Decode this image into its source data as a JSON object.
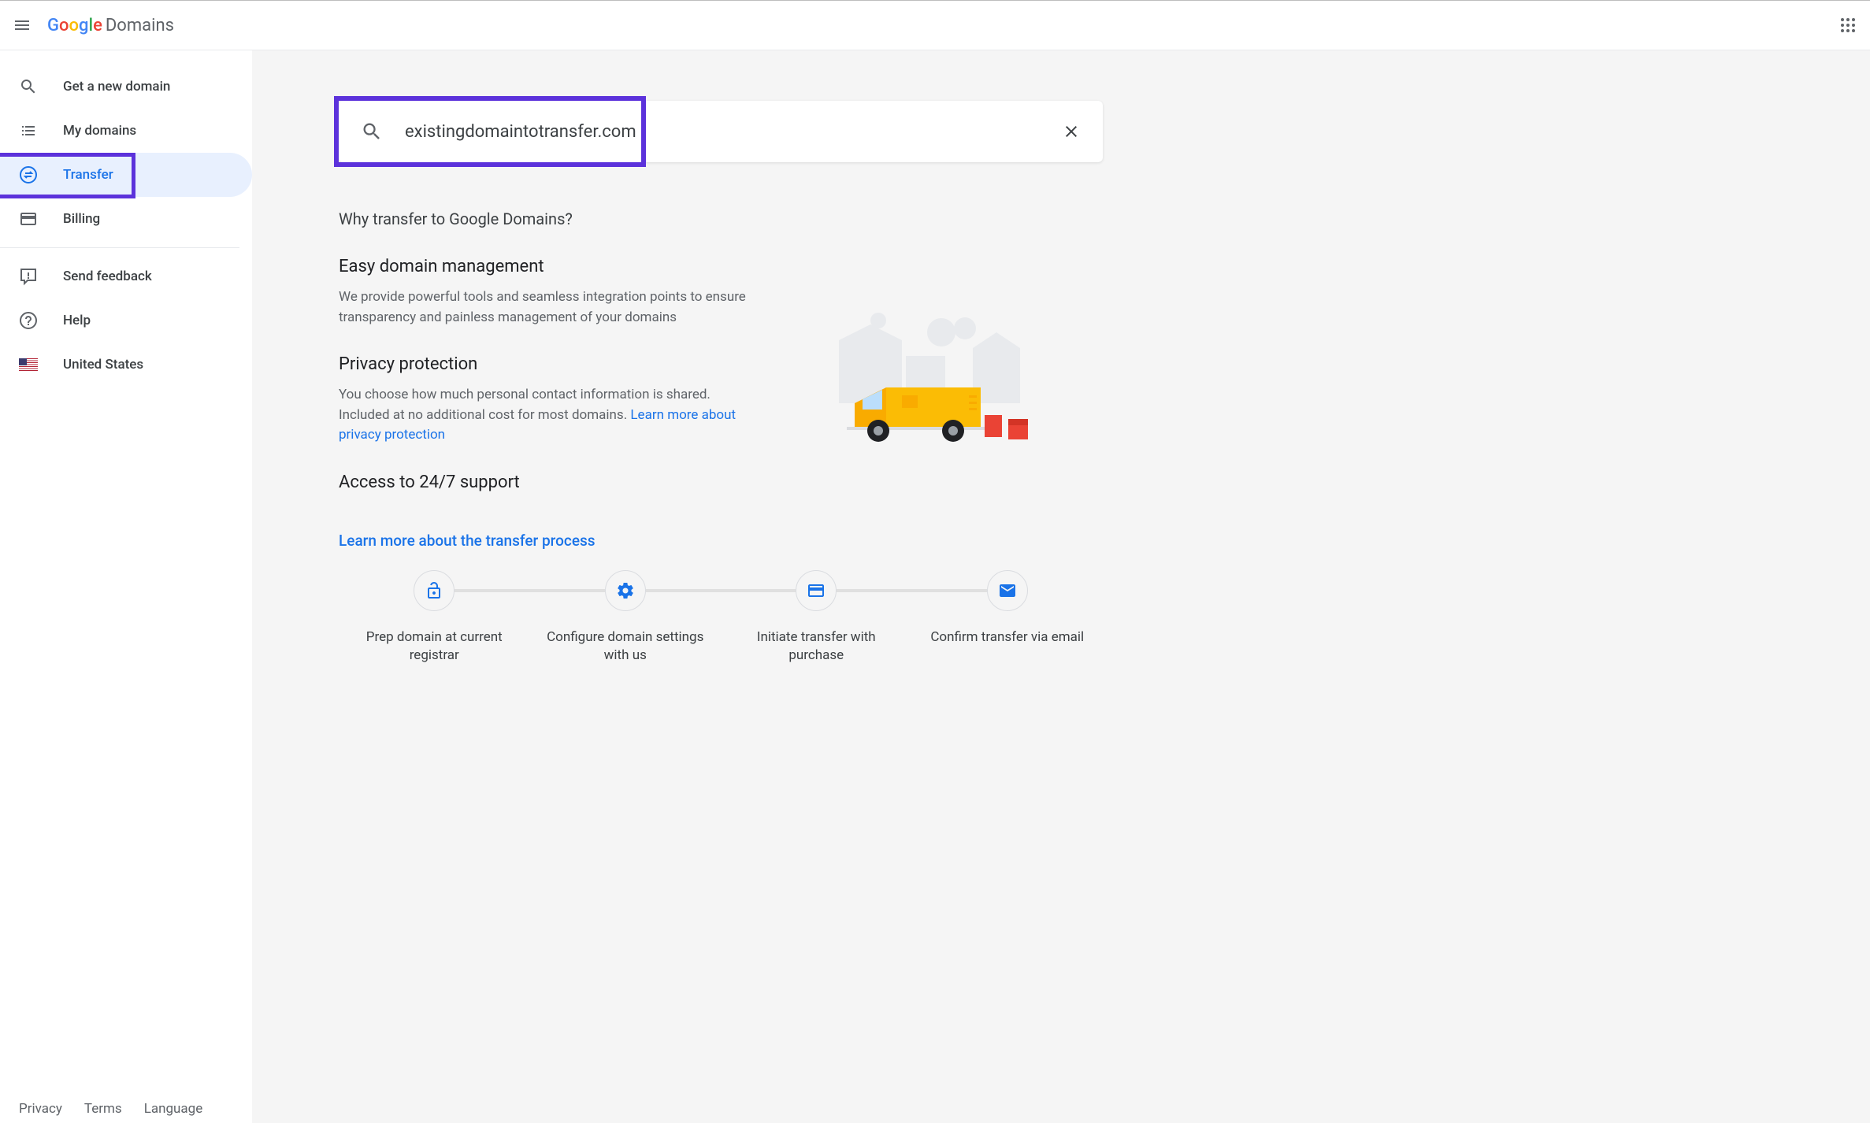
{
  "header": {
    "logo_suffix": "Domains"
  },
  "sidebar": {
    "items": [
      {
        "label": "Get a new domain"
      },
      {
        "label": "My domains"
      },
      {
        "label": "Transfer"
      },
      {
        "label": "Billing"
      },
      {
        "label": "Send feedback"
      },
      {
        "label": "Help"
      },
      {
        "label": "United States"
      }
    ],
    "footer": {
      "privacy": "Privacy",
      "terms": "Terms",
      "language": "Language"
    }
  },
  "search": {
    "value": "existingdomaintotransfer.com"
  },
  "content": {
    "section_title": "Why transfer to Google Domains?",
    "features": [
      {
        "title": "Easy domain management",
        "body": "We provide powerful tools and seamless integration points to ensure transparency and painless management of your domains"
      },
      {
        "title": "Privacy protection",
        "body": "You choose how much personal contact information is shared. Included at no additional cost for most domains. ",
        "link": "Learn more about privacy protection"
      },
      {
        "title": "Access to 24/7 support",
        "body": ""
      }
    ],
    "learn_link": "Learn more about the transfer process",
    "steps": [
      {
        "label": "Prep domain at current registrar"
      },
      {
        "label": "Configure domain settings with us"
      },
      {
        "label": "Initiate transfer with purchase"
      },
      {
        "label": "Confirm transfer via email"
      }
    ]
  },
  "annotations": {
    "highlight_color": "#5c32db"
  }
}
